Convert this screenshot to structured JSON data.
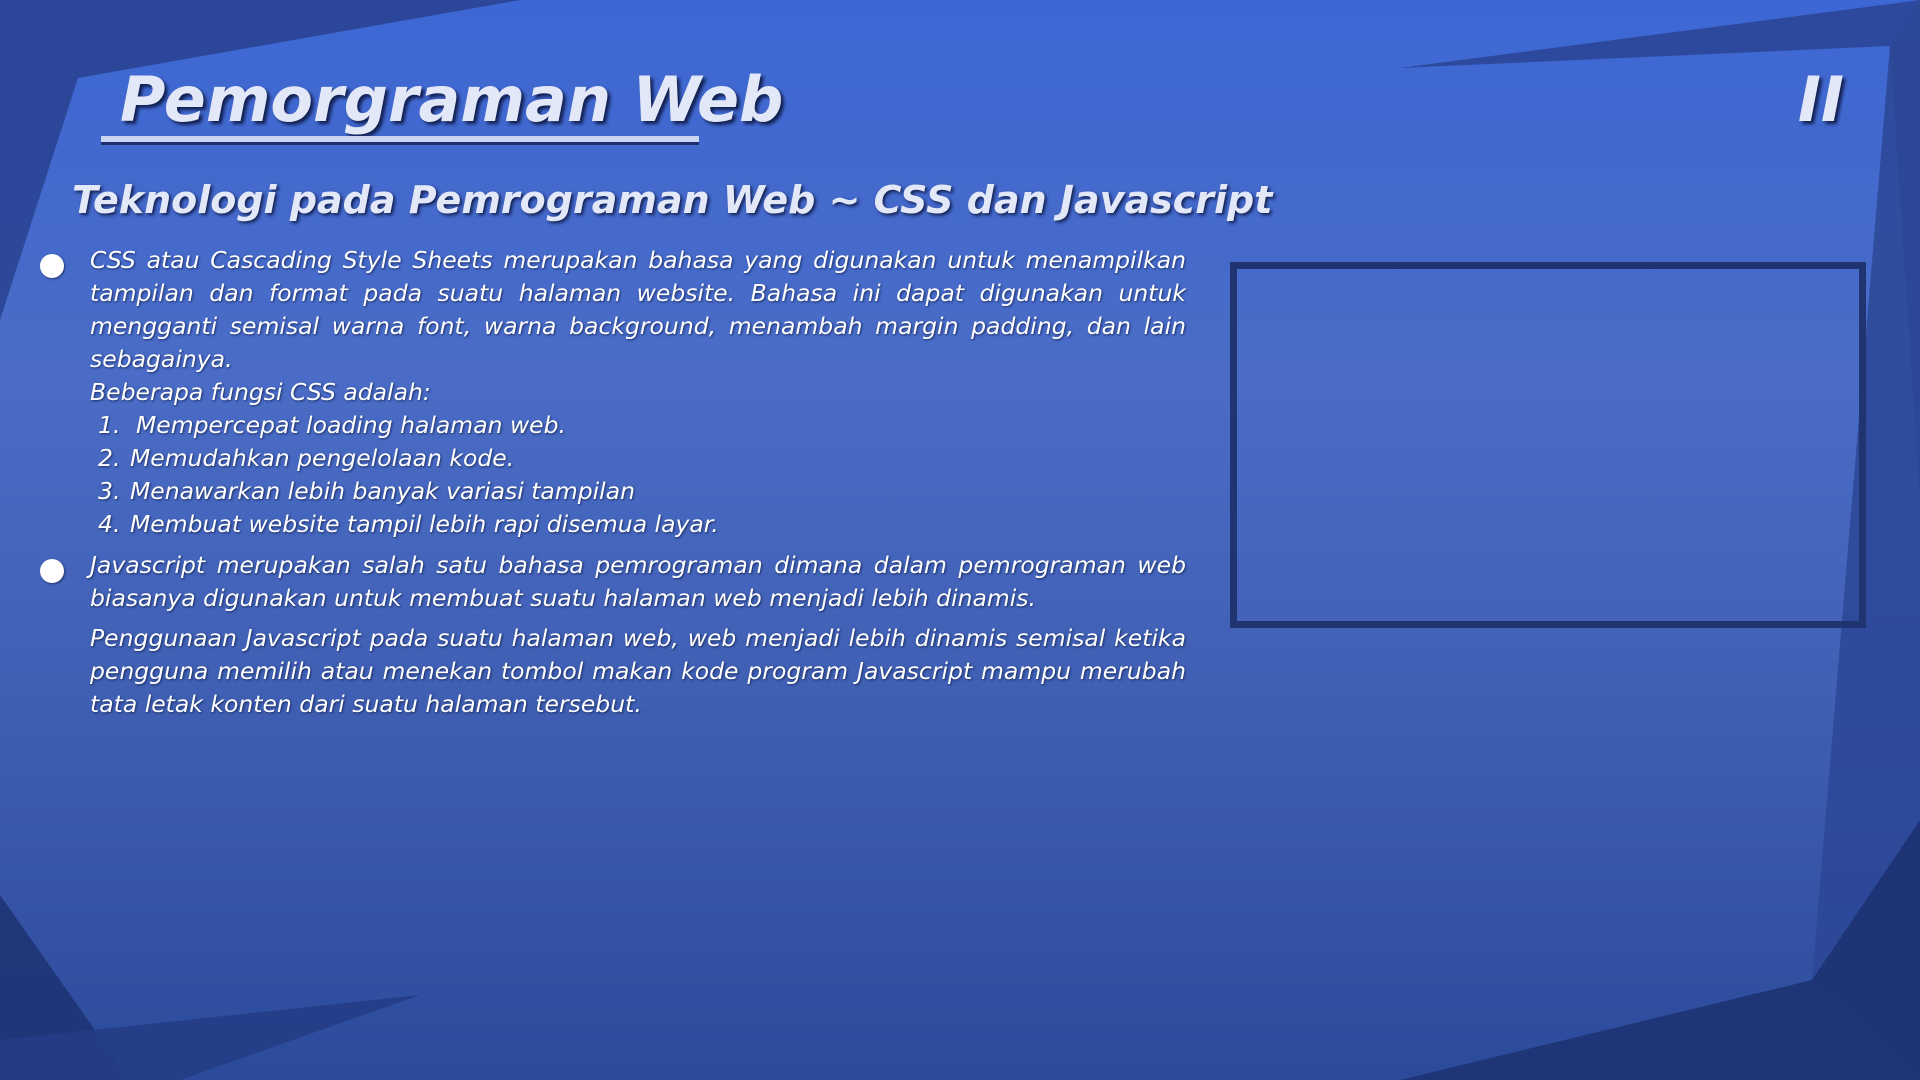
{
  "slide": {
    "title": "Pemorgraman Web",
    "page_number": "II",
    "subtitle": "Teknologi pada Pemrograman Web ~ CSS dan Javascript"
  },
  "bullets": [
    {
      "paragraphs": [
        "CSS atau Cascading Style Sheets merupakan bahasa yang digunakan untuk menampilkan tampilan dan format pada suatu halaman website. Bahasa ini dapat digunakan untuk mengganti semisal warna font, warna background, menambah margin padding, dan lain sebagainya.",
        "Beberapa fungsi CSS adalah:"
      ],
      "list": [
        {
          "num": "1.",
          "text": "Mempercepat loading halaman web."
        },
        {
          "num": "2.",
          "text": "Memudahkan pengelolaan kode."
        },
        {
          "num": "3.",
          "text": "Menawarkan lebih banyak variasi tampilan"
        },
        {
          "num": "4.",
          "text": "Membuat website tampil lebih rapi disemua layar."
        }
      ]
    },
    {
      "paragraphs": [
        "Javascript merupakan salah satu bahasa pemrograman dimana dalam pemrograman web biasanya digunakan untuk membuat suatu halaman web menjadi lebih dinamis.",
        "Penggunaan Javascript pada suatu halaman web, web menjadi lebih dinamis semisal ketika pengguna memilih atau menekan tombol makan kode program Javascript mampu merubah tata letak konten dari suatu halaman tersebut."
      ]
    }
  ],
  "colors": {
    "background_top": "#3d67d4",
    "background_bottom": "#2c4a9a",
    "dark_shape": "#22397f",
    "frame_border": "#1f3470",
    "text": "#ffffff"
  }
}
